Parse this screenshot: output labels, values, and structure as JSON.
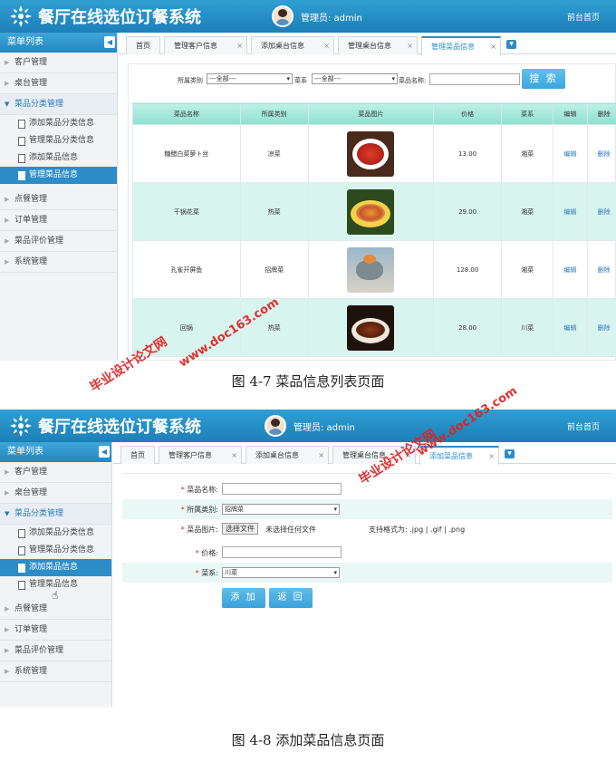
{
  "app": {
    "title": "餐厅在线选位订餐系统",
    "admin": "管理员: admin",
    "front": "前台首页"
  },
  "sidebar": {
    "title": "菜单列表",
    "menus": [
      "客户管理",
      "桌台管理",
      "菜品分类管理",
      "点餐管理",
      "订单管理",
      "菜品评价管理",
      "系统管理"
    ],
    "submenus": [
      "添加菜品分类信息",
      "管理菜品分类信息",
      "添加菜品信息",
      "管理菜品信息"
    ]
  },
  "tabs1": [
    "首页",
    "管理客户信息",
    "添加桌台信息",
    "管理桌台信息",
    "管理菜品信息"
  ],
  "tabs2": [
    "首页",
    "管理客户信息",
    "添加桌台信息",
    "管理桌台信息",
    "添加菜品信息"
  ],
  "search": {
    "category_label": "所属类别",
    "category_value": "---全部---",
    "cuisine_label": "菜系",
    "cuisine_value": "---全部---",
    "name_label": "菜品名称:",
    "name_value": "",
    "button": "搜 索"
  },
  "table": {
    "headers": [
      "菜品名称",
      "所属类别",
      "菜品图片",
      "价格",
      "菜系",
      "编辑",
      "删除"
    ],
    "rows": [
      {
        "name": "糖醋白菜萝卜丝",
        "category": "凉菜",
        "price": "13.00",
        "cuisine": "湘菜",
        "edit": "编辑",
        "del": "删除"
      },
      {
        "name": "干锅花菜",
        "category": "热菜",
        "price": "29.00",
        "cuisine": "湘菜",
        "edit": "编辑",
        "del": "删除"
      },
      {
        "name": "孔雀开屏鱼",
        "category": "招牌菜",
        "price": "128.00",
        "cuisine": "湘菜",
        "edit": "编辑",
        "del": "删除"
      },
      {
        "name": "回锅",
        "category": "热菜",
        "price": "28.00",
        "cuisine": "川菜",
        "edit": "编辑",
        "del": "删除"
      }
    ]
  },
  "form": {
    "name_label": "菜品名称:",
    "category_label": "所属类别:",
    "category_value": "招牌菜",
    "image_label": "菜品图片:",
    "file_button": "选择文件",
    "file_status": "未选择任何文件",
    "formats": "支持格式为: .jpg | .gif | .png",
    "price_label": "价格:",
    "cuisine_label": "菜系:",
    "cuisine_value": "川菜",
    "add_button": "添 加",
    "back_button": "返 回"
  },
  "captions": {
    "fig1": "图 4-7 菜品信息列表页面",
    "fig2": "图 4-8 添加菜品信息页面"
  },
  "watermarks": {
    "site": "www.doc163.com",
    "brand": "毕业设计论文网"
  },
  "colors": {
    "header": "#2f9fd2",
    "active": "#2d8dc8",
    "table_head": "#bff0e6",
    "watermark": "#e02020"
  }
}
